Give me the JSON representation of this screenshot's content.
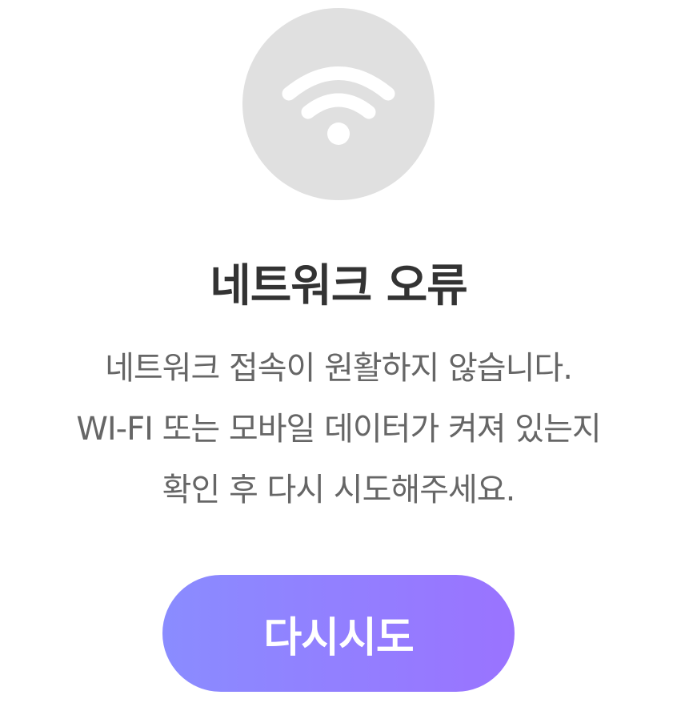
{
  "error": {
    "icon": "wifi-icon",
    "title": "네트워크 오류",
    "message_lines": [
      "네트워크 접속이 원활하지 않습니다.",
      "WI-FI 또는 모바일 데이터가 켜져 있는지",
      "확인 후 다시 시도해주세요."
    ]
  },
  "actions": {
    "retry_label": "다시시도"
  },
  "colors": {
    "icon_background": "#e0e0e0",
    "icon_foreground": "#ffffff",
    "title": "#333333",
    "message": "#666666",
    "button_gradient_start": "#8a8cff",
    "button_gradient_end": "#9a73ff"
  }
}
